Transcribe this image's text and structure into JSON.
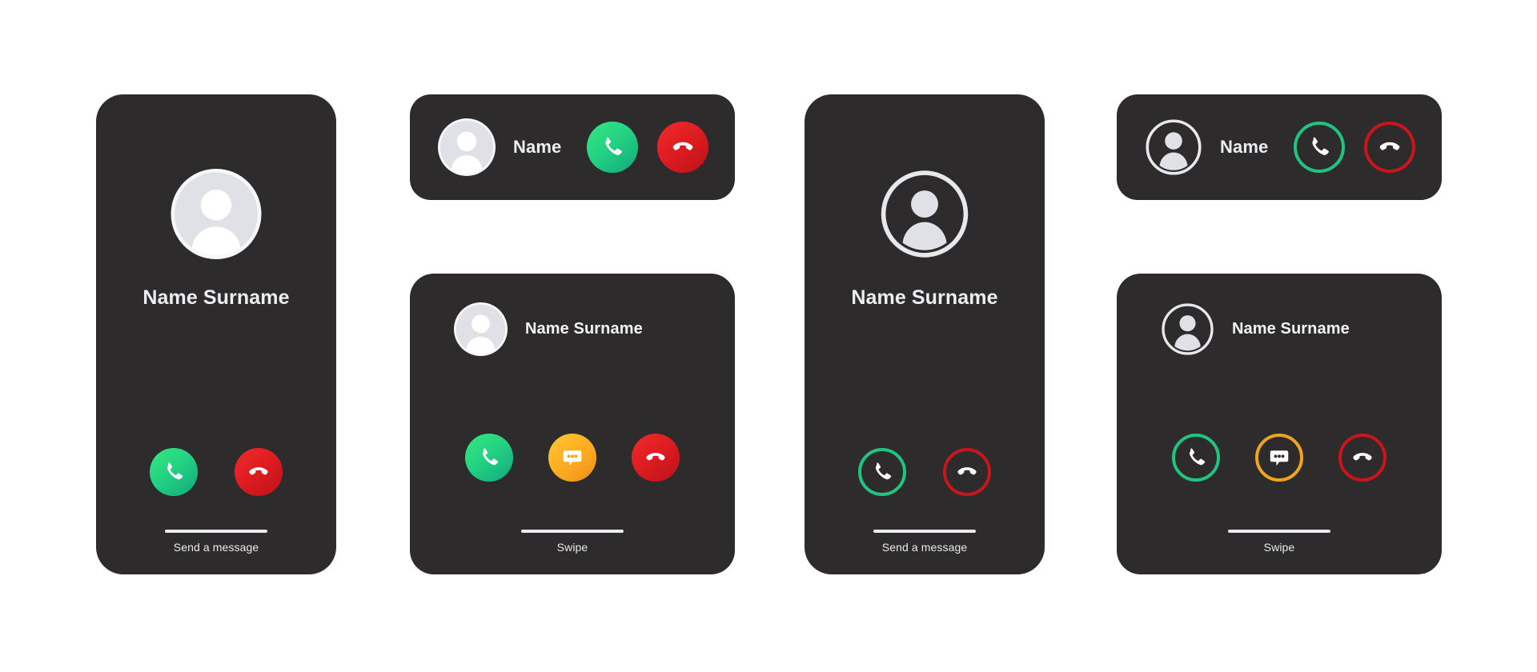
{
  "theme": {
    "page_background": "#ffffff",
    "card_background": "#2e2b2c",
    "text_primary": "#eceef1",
    "accent_green_light": "#2ee57f",
    "accent_green_dark": "#10a57a",
    "accent_red_light": "#e8242a",
    "accent_red_dark": "#b21118",
    "accent_amber_light": "#ffc233",
    "accent_amber_dark": "#f2921a",
    "avatar_fill": "#dfe1e6",
    "avatar_outline": "#e6e8eb"
  },
  "cards": [
    {
      "id": "incoming-call-fullscreen-filled",
      "style": "filled",
      "avatar": "person-avatar",
      "name": "Name Surname",
      "buttons": [
        {
          "name": "accept-call-button",
          "icon": "phone-icon",
          "color": "green"
        },
        {
          "name": "decline-call-button",
          "icon": "phone-hangup-icon",
          "color": "red"
        }
      ],
      "footer_hint": "Send a message"
    },
    {
      "id": "incoming-call-banner-filled",
      "style": "filled",
      "avatar": "person-avatar",
      "name": "Name",
      "buttons": [
        {
          "name": "accept-call-button",
          "icon": "phone-icon",
          "color": "green"
        },
        {
          "name": "decline-call-button",
          "icon": "phone-hangup-icon",
          "color": "red"
        }
      ]
    },
    {
      "id": "incoming-call-panel-filled",
      "style": "filled",
      "avatar": "person-avatar",
      "name": "Name Surname",
      "buttons": [
        {
          "name": "accept-call-button",
          "icon": "phone-icon",
          "color": "green"
        },
        {
          "name": "message-button",
          "icon": "message-bubble-icon",
          "color": "amber"
        },
        {
          "name": "decline-call-button",
          "icon": "phone-hangup-icon",
          "color": "red"
        }
      ],
      "footer_hint": "Swipe"
    },
    {
      "id": "incoming-call-fullscreen-outline",
      "style": "outline",
      "avatar": "person-avatar",
      "name": "Name Surname",
      "buttons": [
        {
          "name": "accept-call-button",
          "icon": "phone-icon",
          "color": "green"
        },
        {
          "name": "decline-call-button",
          "icon": "phone-hangup-icon",
          "color": "red"
        }
      ],
      "footer_hint": "Send a message"
    },
    {
      "id": "incoming-call-banner-outline",
      "style": "outline",
      "avatar": "person-avatar",
      "name": "Name",
      "buttons": [
        {
          "name": "accept-call-button",
          "icon": "phone-icon",
          "color": "green"
        },
        {
          "name": "decline-call-button",
          "icon": "phone-hangup-icon",
          "color": "red"
        }
      ]
    },
    {
      "id": "incoming-call-panel-outline",
      "style": "outline",
      "avatar": "person-avatar",
      "name": "Name Surname",
      "buttons": [
        {
          "name": "accept-call-button",
          "icon": "phone-icon",
          "color": "green"
        },
        {
          "name": "message-button",
          "icon": "message-bubble-icon",
          "color": "amber"
        },
        {
          "name": "decline-call-button",
          "icon": "phone-hangup-icon",
          "color": "red"
        }
      ],
      "footer_hint": "Swipe"
    }
  ]
}
